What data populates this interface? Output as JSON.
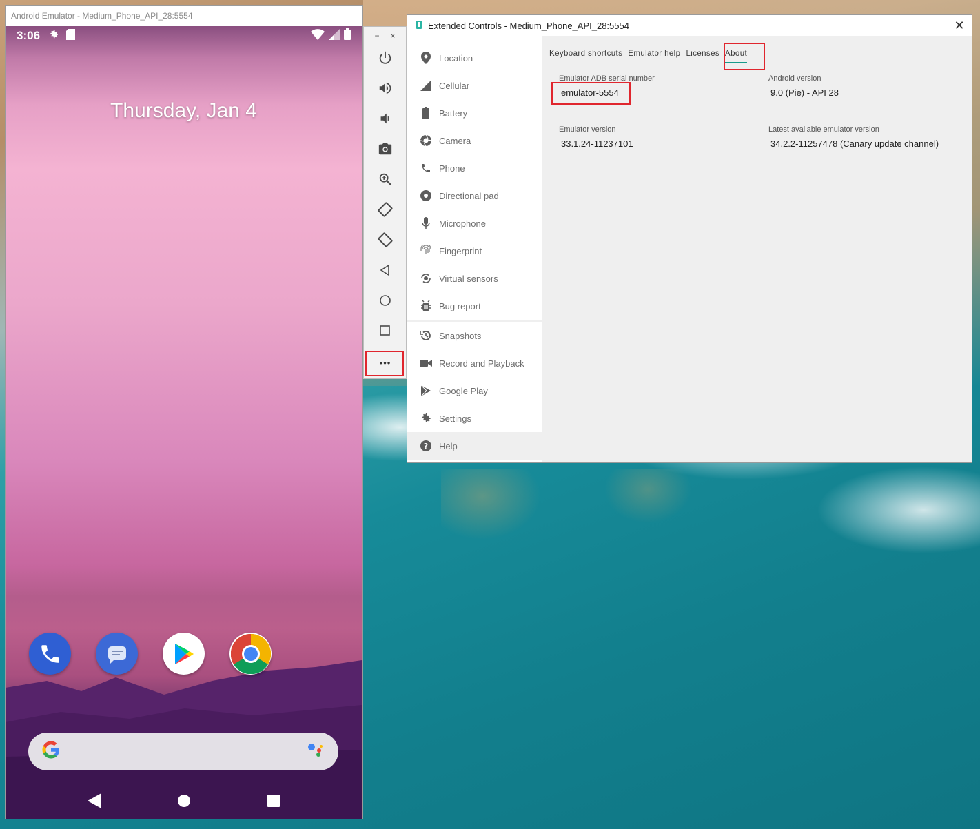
{
  "emulator": {
    "title": "Android Emulator - Medium_Phone_API_28:5554",
    "status_time": "3:06",
    "date": "Thursday, Jan 4",
    "dock_apps": [
      "phone-app",
      "messages-app",
      "play-store-app",
      "chrome-app"
    ]
  },
  "toolbar": {
    "buttons": [
      "power",
      "volume-up",
      "volume-down",
      "screenshot",
      "zoom",
      "rotate-left",
      "rotate-right",
      "back",
      "home",
      "overview",
      "more"
    ],
    "more_label": "•••",
    "minimize": "−",
    "close": "×"
  },
  "extended": {
    "title": "Extended Controls - Medium_Phone_API_28:5554",
    "nav": [
      {
        "label": "Location",
        "icon": "location-pin-icon"
      },
      {
        "label": "Cellular",
        "icon": "cellular-signal-icon"
      },
      {
        "label": "Battery",
        "icon": "battery-icon"
      },
      {
        "label": "Camera",
        "icon": "camera-shutter-icon"
      },
      {
        "label": "Phone",
        "icon": "phone-icon"
      },
      {
        "label": "Directional pad",
        "icon": "dpad-icon"
      },
      {
        "label": "Microphone",
        "icon": "microphone-icon"
      },
      {
        "label": "Fingerprint",
        "icon": "fingerprint-icon"
      },
      {
        "label": "Virtual sensors",
        "icon": "sensors-icon"
      },
      {
        "label": "Bug report",
        "icon": "bug-icon"
      }
    ],
    "nav2": [
      {
        "label": "Snapshots",
        "icon": "history-icon"
      },
      {
        "label": "Record and Playback",
        "icon": "video-camera-icon"
      },
      {
        "label": "Google Play",
        "icon": "play-icon"
      },
      {
        "label": "Settings",
        "icon": "gear-icon"
      }
    ],
    "nav_help": {
      "label": "Help",
      "icon": "help-icon"
    },
    "tabs": [
      "Keyboard shortcuts",
      "Emulator help",
      "Licenses",
      "About"
    ],
    "about": {
      "adb_label": "Emulator ADB serial number",
      "adb_value": "emulator-5554",
      "android_label": "Android version",
      "android_value": "9.0 (Pie) - API 28",
      "emu_version_label": "Emulator version",
      "emu_version_value": "33.1.24-11237101",
      "latest_label": "Latest available emulator version",
      "latest_value": "34.2.2-11257478 (Canary update channel)"
    }
  },
  "colors": {
    "accent": "#1a9b8b",
    "highlight": "#e0262e",
    "nav_text": "#6d6d6d"
  }
}
